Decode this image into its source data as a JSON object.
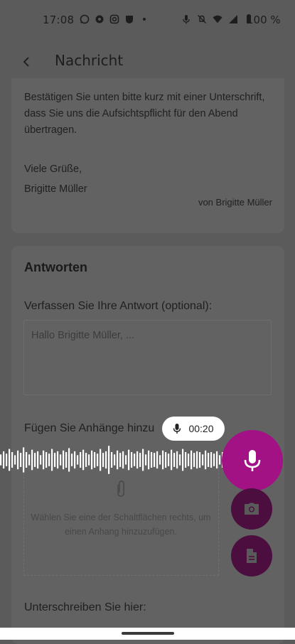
{
  "status_bar": {
    "time": "17:08",
    "battery": "100 %",
    "icons": [
      "whatsapp-icon",
      "settings-icon",
      "instagram-icon",
      "shield-icon",
      "dot-icon",
      "mic-icon",
      "mute-icon",
      "wifi-icon",
      "signal-icon",
      "battery-icon"
    ]
  },
  "app_bar": {
    "title": "Nachricht",
    "back_icon": "arrow-back-icon"
  },
  "message": {
    "body": "Bestätigen Sie unten bitte kurz mit einer Unterschrift, dass Sie uns die Aufsichtspflicht für den Abend übertragen.",
    "greeting": "Viele Grüße,",
    "signature": "Brigitte Müller",
    "from": "von Brigitte Müller"
  },
  "reply": {
    "title": "Antworten",
    "compose_label": "Verfassen Sie Ihre Antwort (optional):",
    "compose_placeholder": "Hallo Brigitte Müller, ...",
    "attachments_label": "Fügen Sie Anhänge hinzu",
    "attachments_hint": "Wählen Sie eine der Schaltflächen rechts, um einen Anhang hinzuzufügen.",
    "sign_label": "Unterschreiben Sie hier:"
  },
  "recording": {
    "timer": "00:20",
    "level": [
      0.35,
      0.55,
      0.4,
      0.7,
      0.5,
      0.3,
      0.6,
      0.45,
      0.8,
      0.5,
      0.35,
      0.65,
      0.45,
      0.55,
      0.3,
      0.6,
      0.5,
      0.4,
      0.7,
      0.45,
      0.55,
      0.35,
      0.6,
      0.5,
      0.75,
      0.4,
      0.55,
      0.3,
      0.5,
      0.65,
      0.45,
      0.35,
      0.6,
      0.5,
      0.4,
      0.7,
      0.45,
      0.55,
      0.9,
      0.5,
      0.35,
      0.6,
      0.45,
      0.55,
      0.3,
      0.65,
      0.5,
      0.4,
      0.55,
      0.45,
      0.7,
      0.35,
      0.6,
      0.5,
      0.45,
      0.55,
      0.3,
      0.6,
      0.5,
      0.4,
      0.65,
      0.45,
      0.55,
      0.35,
      0.7,
      0.5,
      0.4,
      0.6,
      0.45,
      0.55,
      0.5,
      0.35,
      0.6,
      0.45,
      0.5,
      0.4,
      0.55,
      0.3,
      0.5,
      0.45
    ]
  },
  "colors": {
    "accent": "#a31285",
    "accent_dark": "#4c0e3f",
    "scrim": "#5b5b5b"
  }
}
